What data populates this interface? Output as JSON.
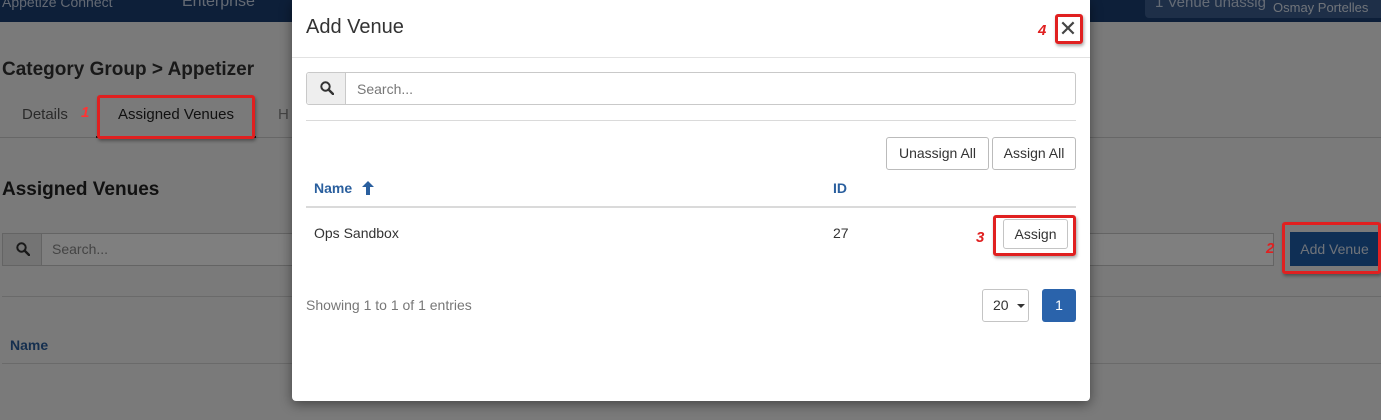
{
  "background": {
    "topbar": {
      "brand": "Appetize Connect",
      "section": "Enterprise",
      "notice": "1 Venue unassig",
      "user": "Osmay Portelles"
    },
    "breadcrumb": "Category Group > Appetizer",
    "tabs": [
      {
        "label": "Details"
      },
      {
        "label": "Assigned Venues"
      },
      {
        "label": "H"
      }
    ],
    "section_title": "Assigned Venues",
    "search_placeholder": "Search...",
    "add_venue_label": "Add Venue",
    "table_header_name": "Name"
  },
  "modal": {
    "title": "Add Venue",
    "close_label": "✕",
    "search_placeholder": "Search...",
    "buttons": {
      "unassign_all": "Unassign All",
      "assign_all": "Assign All"
    },
    "columns": {
      "name": "Name",
      "id": "ID"
    },
    "rows": [
      {
        "name": "Ops Sandbox",
        "id": "27",
        "action": "Assign"
      }
    ],
    "footer": {
      "info": "Showing 1 to 1 of 1 entries",
      "page_size": "20",
      "current_page": "1"
    }
  },
  "annotations": {
    "n1": "1",
    "n2": "2",
    "n3": "3",
    "n4": "4"
  },
  "colors": {
    "primary": "#2a63ab",
    "header_text": "#2a5f9e",
    "callout": "#e02020"
  }
}
